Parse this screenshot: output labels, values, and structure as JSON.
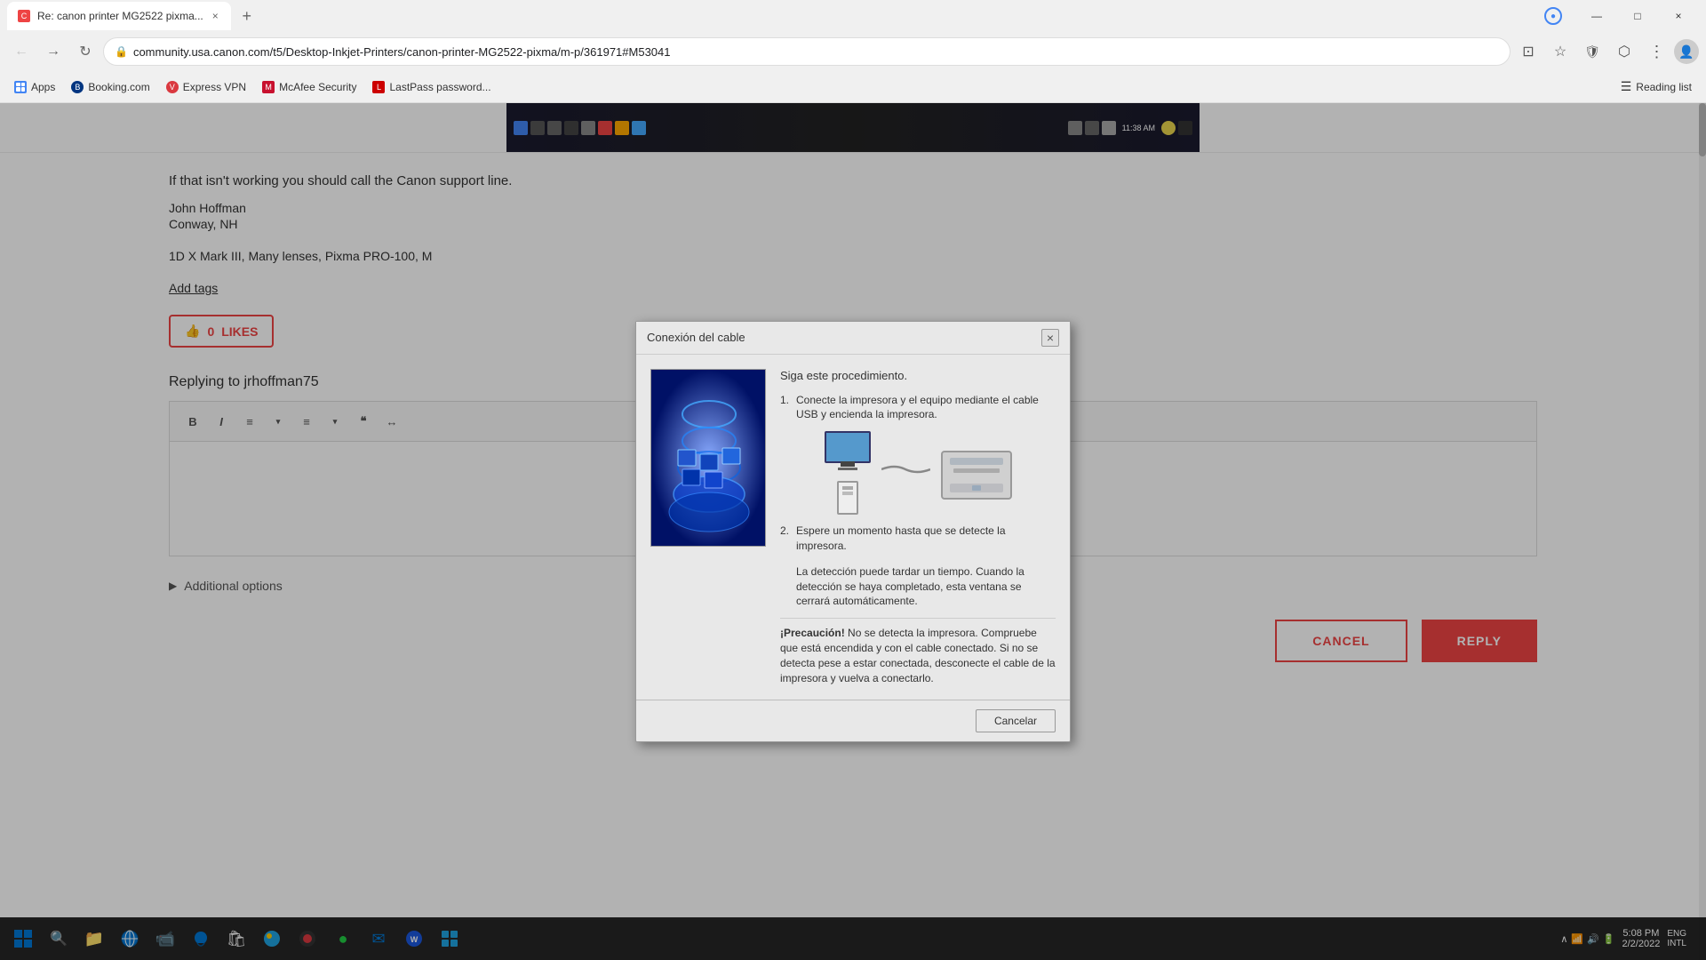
{
  "browser": {
    "tab": {
      "favicon_color": "#e44",
      "title": "Re: canon printer MG2522 pixma...",
      "close_label": "×"
    },
    "new_tab_label": "+",
    "controls": {
      "minimize": "—",
      "maximize": "□",
      "close": "×"
    },
    "nav": {
      "back": "←",
      "forward": "→",
      "reload": "↻",
      "home": "⌂"
    },
    "address": "community.usa.canon.com/t5/Desktop-Inkjet-Printers/canon-printer-MG2522-pixma/m-p/361971#M53041",
    "toolbar_icons": {
      "cast": "⊡",
      "bookmark": "☆",
      "shield": "🛡",
      "extensions": "⬡",
      "profile": "👤"
    }
  },
  "bookmarks": [
    {
      "id": "apps",
      "label": "Apps",
      "favicon": "grid"
    },
    {
      "id": "booking",
      "label": "Booking.com",
      "favicon": "globe"
    },
    {
      "id": "expressvpn",
      "label": "Express VPN",
      "favicon": "globe"
    },
    {
      "id": "mcafee",
      "label": "McAfee Security",
      "favicon": "globe"
    },
    {
      "id": "lastpass",
      "label": "LastPass password...",
      "favicon": "globe"
    }
  ],
  "reading_list": {
    "icon": "☰",
    "label": "Reading list"
  },
  "page": {
    "support_line_text": "If that isn't working you should call the Canon support line.",
    "author": "John Hoffman",
    "location": "Conway, NH",
    "equipment": "1D X Mark III, Many lenses, Pixma PRO-100, M",
    "add_tags": "Add tags",
    "likes_count": "0",
    "likes_label": "LIKES",
    "like_icon": "👍",
    "replying_label": "Replying to jrhoffman75",
    "toolbar_buttons": [
      "B",
      "I",
      "≡",
      "▾",
      "≡",
      "▾",
      "❝",
      "↔"
    ],
    "additional_options": "Additional options",
    "cancel_label": "CANCEL",
    "reply_label": "REPLY"
  },
  "modal": {
    "title": "Conexión del cable",
    "close_label": "×",
    "step_intro": "Siga este procedimiento.",
    "step1_num": "1.",
    "step1_text": "Conecte la impresora y el equipo mediante el cable USB y encienda la impresora.",
    "step2_num": "2.",
    "step2_text": "Espere un momento hasta que se detecte la impresora.",
    "step2_detail": "La detección puede tardar un tiempo. Cuando la detección se haya completado, esta ventana se cerrará automáticamente.",
    "warning": "¡Precaución! No se detecta la impresora. Compruebe que está encendida y con el cable conectado. Si no se detecta pese a estar conectada, desconecte el cable de la impresora y vuelva a conectarlo.",
    "cancel_label": "Cancelar"
  },
  "taskbar": {
    "time": "5:08 PM",
    "date": "2/2/2022",
    "lang": "ENG",
    "region": "INTL"
  }
}
